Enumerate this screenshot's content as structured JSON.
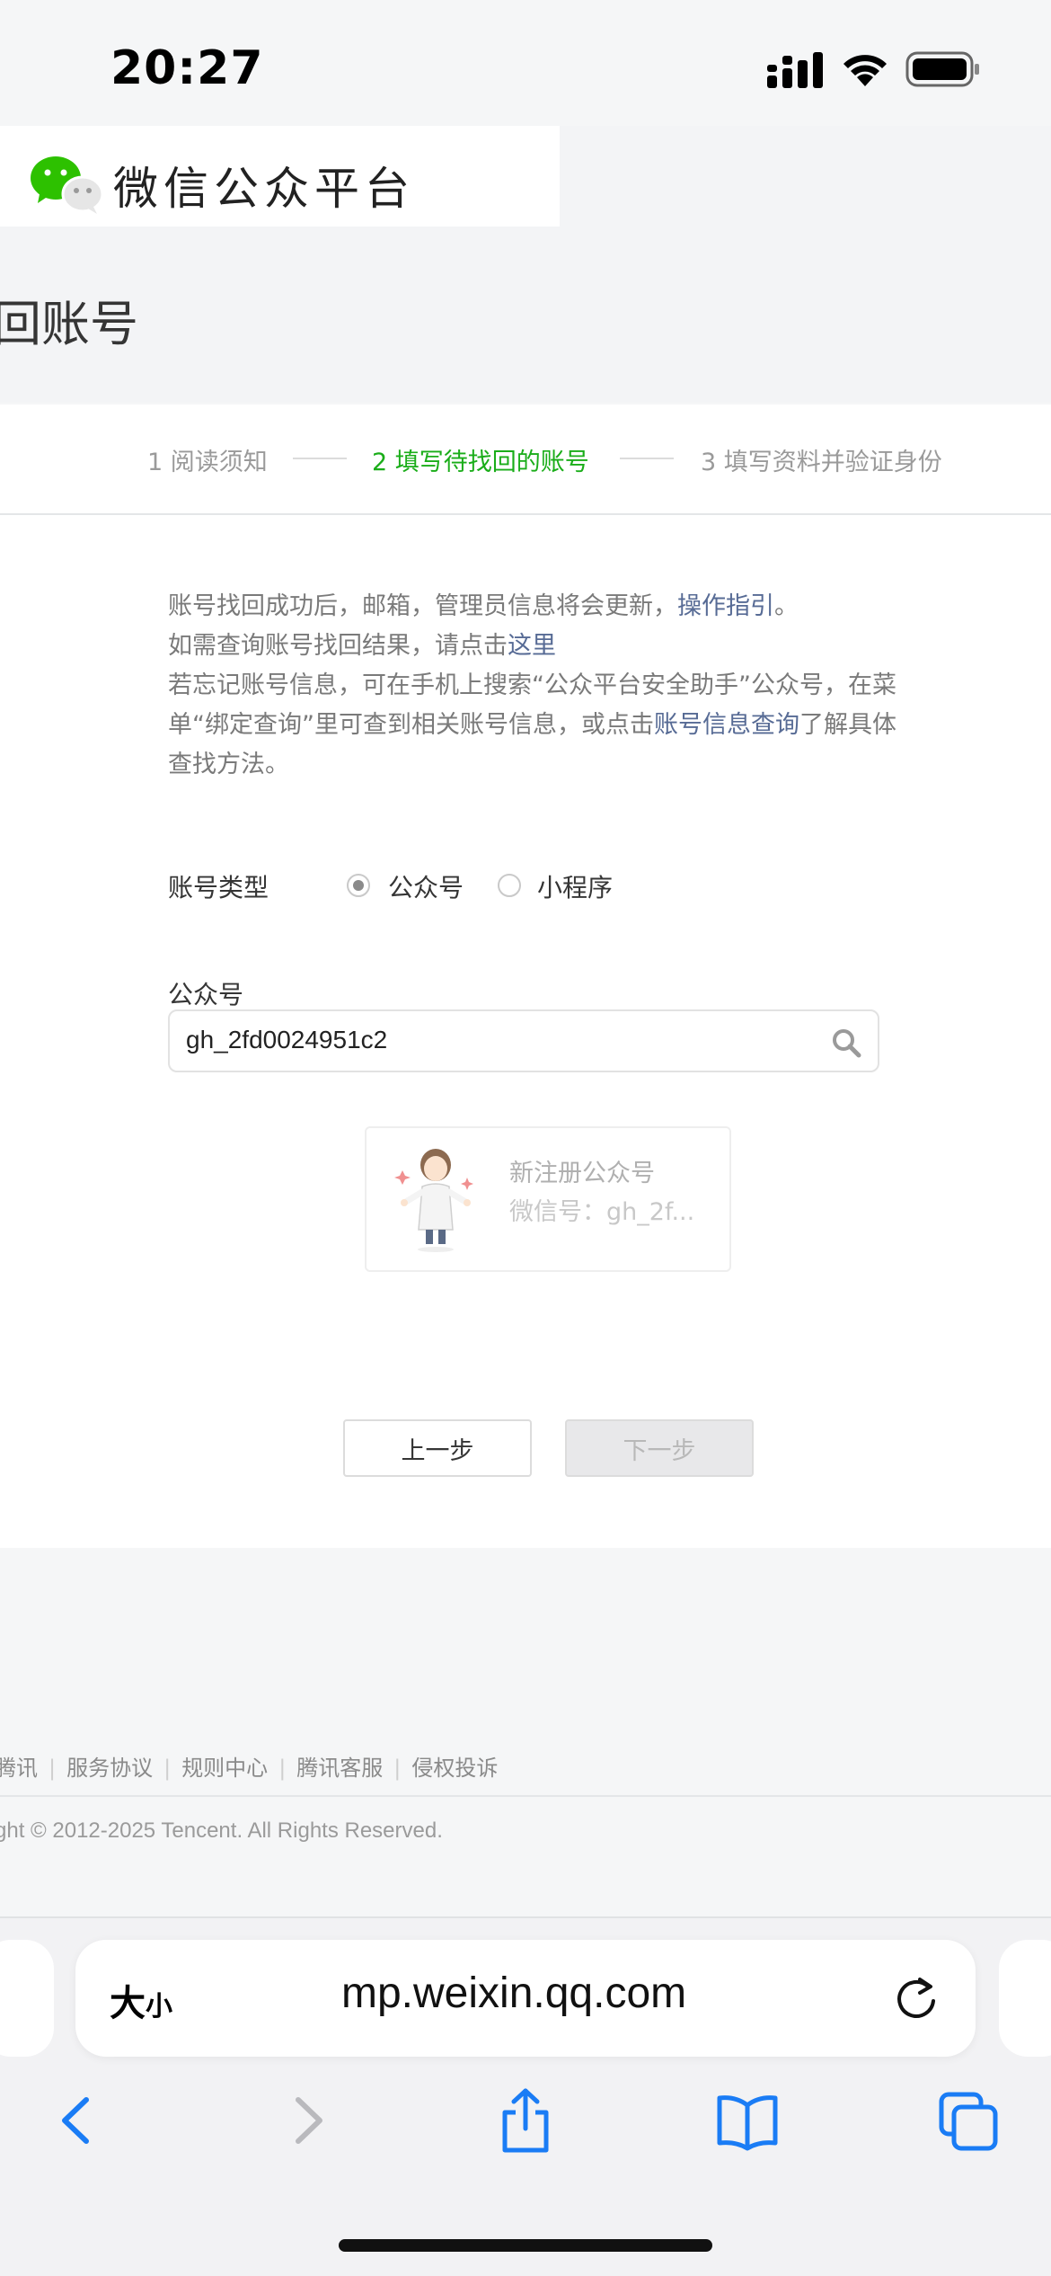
{
  "status_bar": {
    "time": "20:27"
  },
  "header": {
    "site_title": "微信公众平台",
    "page_title": "回账号"
  },
  "steps": [
    {
      "label": "1 阅读须知"
    },
    {
      "label": "2 填写待找回的账号"
    },
    {
      "label": "3 填写资料并验证身份"
    }
  ],
  "colors": {
    "active_step": "#1aad19",
    "link": "#576b95"
  },
  "notice": {
    "line1_text": "账号找回成功后，邮箱，管理员信息将会更新，",
    "line1_link": "操作指引",
    "line1_end": "。",
    "line2_text": "如需查询账号找回结果，请点击",
    "line2_link": "这里",
    "line3_text": "若忘记账号信息，可在手机上搜索“公众平台安全助手”公众号，在菜单“绑定查询”里可查到相关账号信息，或点击",
    "line3_link": "账号信息查询",
    "line3_end": "了解具体查找方法。"
  },
  "form": {
    "account_type_label": "账号类型",
    "radio_options": [
      "公众号",
      "小程序"
    ],
    "selected_option": "公众号",
    "account_field_label": "公众号",
    "account_value": "gh_2fd0024951c2"
  },
  "result": {
    "name": "新注册公众号",
    "wechat_id": "微信号：gh_2f..."
  },
  "buttons": {
    "prev": "上一步",
    "next": "下一步"
  },
  "footer": {
    "links": [
      "腾讯",
      "服务协议",
      "规则中心",
      "腾讯客服",
      "侵权投诉"
    ],
    "copyright": "ght © 2012-2025 Tencent. All Rights Reserved."
  },
  "browser": {
    "text_size_big": "大",
    "text_size_small": "小",
    "url": "mp.weixin.qq.com"
  }
}
